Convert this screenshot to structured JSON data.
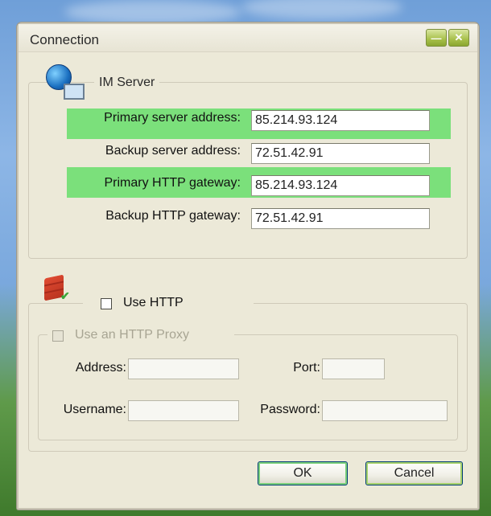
{
  "window": {
    "title": "Connection",
    "minimize_glyph": "—",
    "close_glyph": "✕"
  },
  "im_server": {
    "group_label": "IM Server",
    "icon": "network-globe-icon",
    "rows": [
      {
        "label": "Primary server address:",
        "value": "85.214.93.124",
        "highlighted": true
      },
      {
        "label": "Backup server address:",
        "value": "72.51.42.91",
        "highlighted": false
      },
      {
        "label": "Primary HTTP gateway:",
        "value": "85.214.93.124",
        "highlighted": true
      },
      {
        "label": "Backup HTTP gateway:",
        "value": "72.51.42.91",
        "highlighted": false
      }
    ]
  },
  "http": {
    "icon": "firewall-icon",
    "use_http_label": "Use HTTP",
    "use_http_checked": false,
    "proxy": {
      "use_proxy_label": "Use an HTTP Proxy",
      "use_proxy_checked": false,
      "address_label": "Address:",
      "address_value": "",
      "port_label": "Port:",
      "port_value": "",
      "username_label": "Username:",
      "username_value": "",
      "password_label": "Password:",
      "password_value": ""
    }
  },
  "buttons": {
    "ok": "OK",
    "cancel": "Cancel"
  },
  "colors": {
    "highlight": "#7be07b",
    "dialog_bg": "#ece9d8"
  }
}
